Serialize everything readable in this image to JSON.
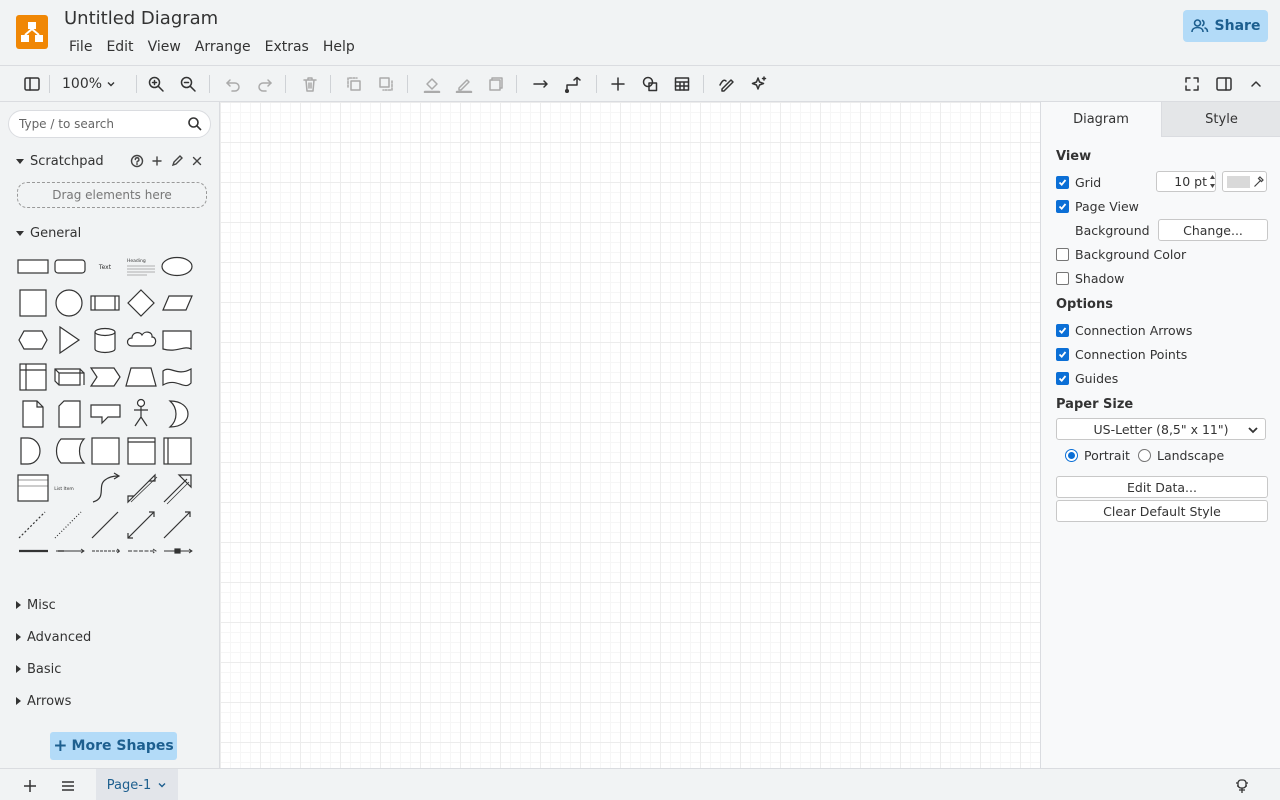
{
  "app": {
    "title": "Untitled Diagram",
    "menus": [
      "File",
      "Edit",
      "View",
      "Arrange",
      "Extras",
      "Help"
    ],
    "share_label": "Share",
    "brand_color": "#f08705"
  },
  "toolbar": {
    "zoom": "100%",
    "icons": [
      "sidebar-toggle-icon",
      "zoom-in-icon",
      "zoom-out-icon",
      "undo-icon",
      "redo-icon",
      "delete-icon",
      "to-front-icon",
      "to-back-icon",
      "fill-color-icon",
      "line-color-icon",
      "shadow-icon",
      "connection-icon",
      "waypoints-icon",
      "insert-icon",
      "shapes-icon",
      "table-icon",
      "freehand-icon",
      "generate-icon",
      "fullscreen-icon",
      "format-panel-icon",
      "collapse-icon"
    ]
  },
  "sidebar": {
    "search_placeholder": "Type / to search",
    "scratchpad": {
      "label": "Scratchpad",
      "drop_text": "Drag elements here"
    },
    "general": {
      "label": "General",
      "text_shape": "Text",
      "heading_shape": "Heading",
      "list_item_shape": "List Item"
    },
    "sections": [
      "Misc",
      "Advanced",
      "Basic",
      "Arrows"
    ],
    "more_shapes": "More Shapes"
  },
  "format_panel": {
    "tabs": {
      "diagram": "Diagram",
      "style": "Style"
    },
    "view": {
      "header": "View",
      "grid": {
        "label": "Grid",
        "checked": true,
        "size": "10 pt"
      },
      "page_view": {
        "label": "Page View",
        "checked": true
      },
      "background": {
        "label": "Background",
        "button": "Change..."
      },
      "background_color": {
        "label": "Background Color",
        "checked": false
      },
      "shadow": {
        "label": "Shadow",
        "checked": false
      }
    },
    "options": {
      "header": "Options",
      "connection_arrows": {
        "label": "Connection Arrows",
        "checked": true
      },
      "connection_points": {
        "label": "Connection Points",
        "checked": true
      },
      "guides": {
        "label": "Guides",
        "checked": true
      }
    },
    "paper_size": {
      "header": "Paper Size",
      "selected": "US-Letter (8,5\" x 11\")",
      "portrait": "Portrait",
      "landscape": "Landscape",
      "orientation": "portrait"
    },
    "edit_data": "Edit Data...",
    "clear_default_style": "Clear Default Style"
  },
  "footer": {
    "page_tab": "Page-1"
  }
}
